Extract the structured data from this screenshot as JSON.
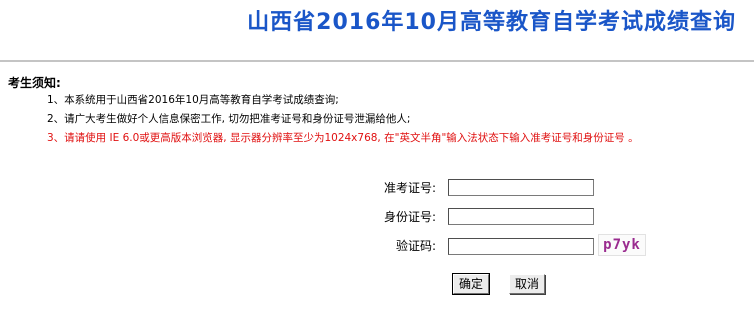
{
  "header": {
    "title": "山西省2016年10月高等教育自学考试成绩查询"
  },
  "notice": {
    "heading": "考生须知:",
    "items": [
      "1、本系统用于山西省2016年10月高等教育自学考试成绩查询;",
      "2、请广大考生做好个人信息保密工作, 切勿把准考证号和身份证号泄漏给他人;",
      "3、请请使用 IE 6.0或更高版本浏览器, 显示器分辨率至少为1024x768, 在\"英文半角\"输入法状态下输入准考证号和身份证号 。"
    ],
    "warning_color": "#e01010"
  },
  "form": {
    "exam_number_label": "准考证号:",
    "exam_number_value": "",
    "id_number_label": "身份证号:",
    "id_number_value": "",
    "captcha_label": "验证码:",
    "captcha_value": "",
    "captcha_text": "p7yk",
    "submit_label": "确定",
    "cancel_label": "取消"
  },
  "colors": {
    "title": "#1a56c8",
    "captcha": "#9a2b8f"
  }
}
